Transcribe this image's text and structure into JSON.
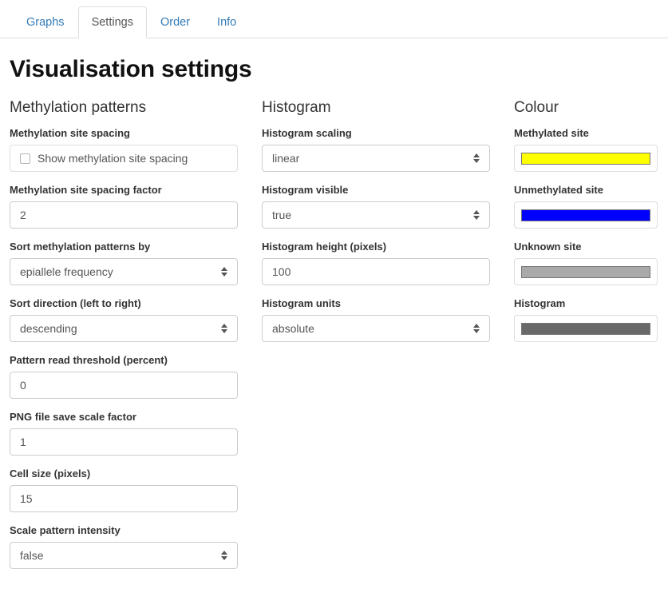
{
  "tabs": [
    {
      "label": "Graphs",
      "active": false
    },
    {
      "label": "Settings",
      "active": true
    },
    {
      "label": "Order",
      "active": false
    },
    {
      "label": "Info",
      "active": false
    }
  ],
  "page_title": "Visualisation settings",
  "columns": {
    "methylation": {
      "heading": "Methylation patterns",
      "fields": {
        "site_spacing": {
          "label": "Methylation site spacing",
          "checkbox_label": "Show methylation site spacing",
          "checked": false
        },
        "spacing_factor": {
          "label": "Methylation site spacing factor",
          "value": "2"
        },
        "sort_by": {
          "label": "Sort methylation patterns by",
          "value": "epiallele frequency"
        },
        "sort_direction": {
          "label": "Sort direction (left to right)",
          "value": "descending"
        },
        "read_threshold": {
          "label": "Pattern read threshold (percent)",
          "value": "0"
        },
        "png_scale": {
          "label": "PNG file save scale factor",
          "value": "1"
        },
        "cell_size": {
          "label": "Cell size (pixels)",
          "value": "15"
        },
        "scale_intensity": {
          "label": "Scale pattern intensity",
          "value": "false"
        }
      }
    },
    "histogram": {
      "heading": "Histogram",
      "fields": {
        "scaling": {
          "label": "Histogram scaling",
          "value": "linear"
        },
        "visible": {
          "label": "Histogram visible",
          "value": "true"
        },
        "height": {
          "label": "Histogram height (pixels)",
          "value": "100"
        },
        "units": {
          "label": "Histogram units",
          "value": "absolute"
        }
      }
    },
    "colour": {
      "heading": "Colour",
      "fields": {
        "methylated": {
          "label": "Methylated site",
          "color": "#FFFF00"
        },
        "unmethylated": {
          "label": "Unmethylated site",
          "color": "#0000FF"
        },
        "unknown": {
          "label": "Unknown site",
          "color": "#A9A9A9"
        },
        "histogram": {
          "label": "Histogram",
          "color": "#696969"
        }
      }
    }
  }
}
